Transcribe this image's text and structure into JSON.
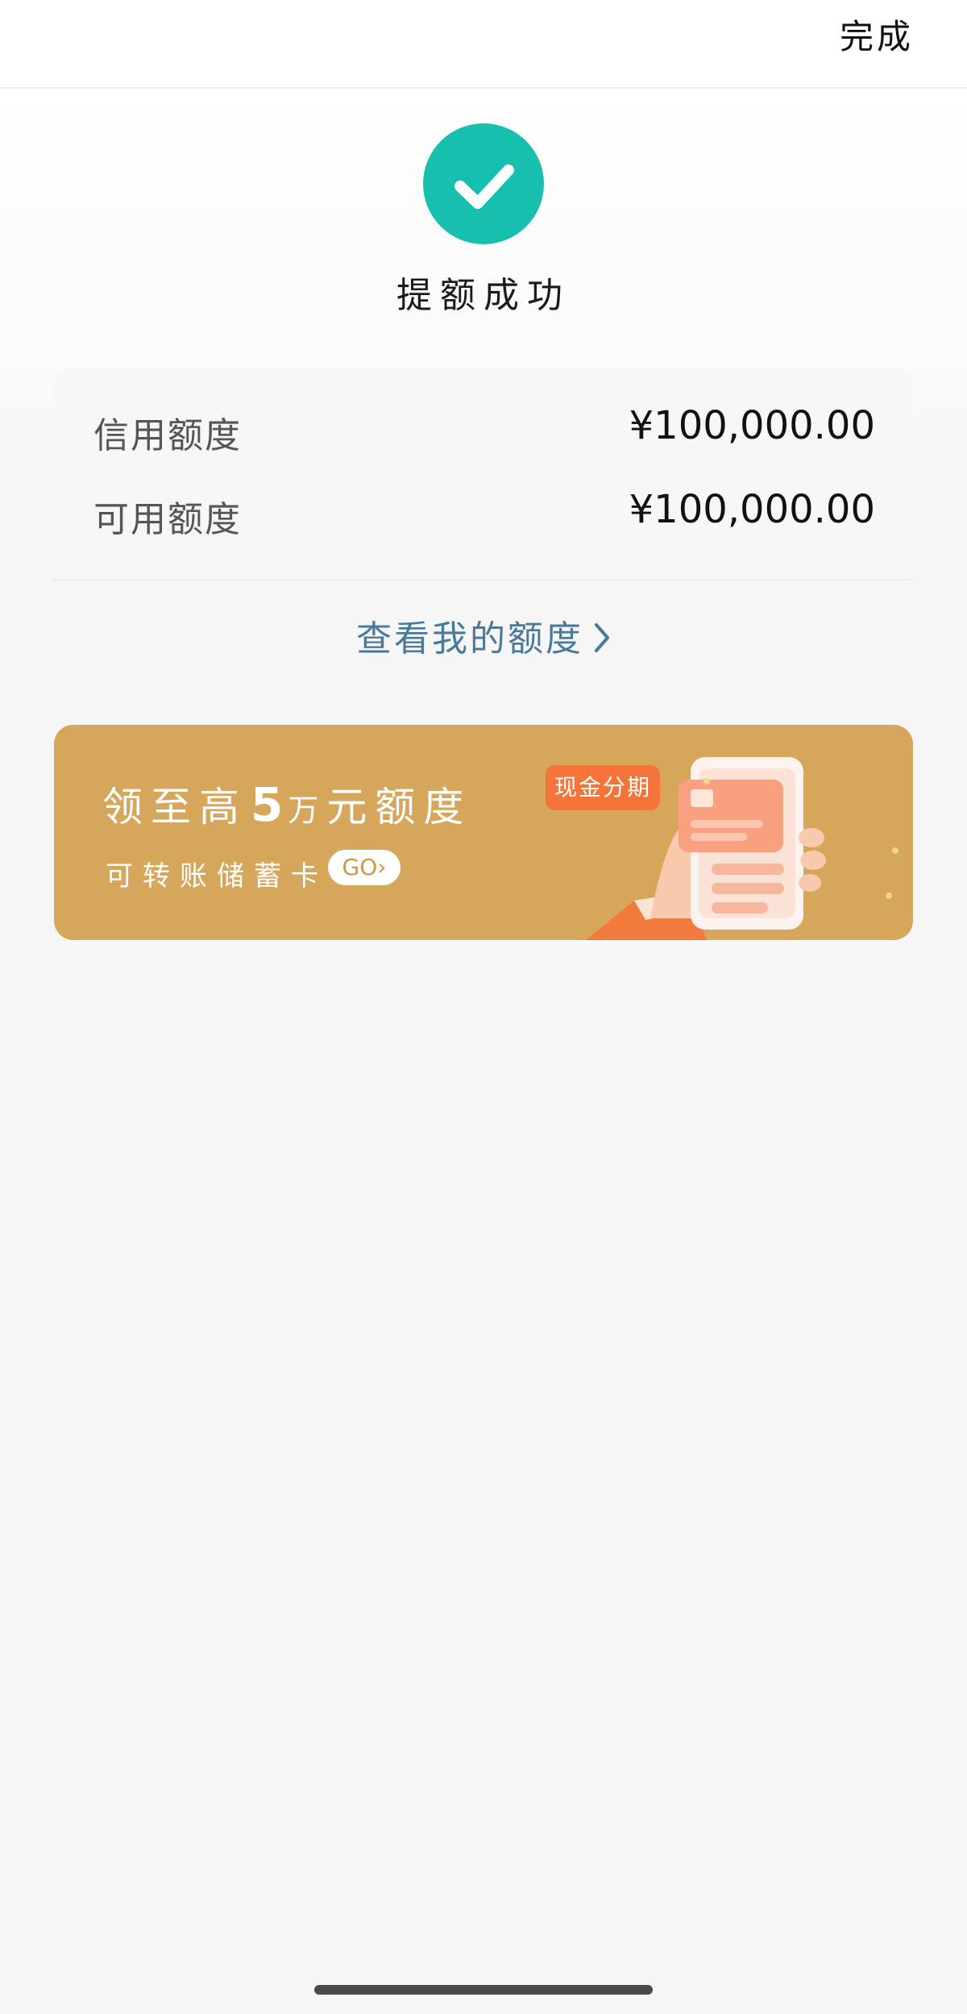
{
  "header": {
    "done_label": "完成"
  },
  "result": {
    "icon": "checkmark-icon",
    "title": "提额成功",
    "icon_color": "#17bfae"
  },
  "limits": {
    "rows": [
      {
        "label": "信用额度",
        "value": "¥100,000.00"
      },
      {
        "label": "可用额度",
        "value": "¥100,000.00"
      }
    ],
    "view_link_label": "查看我的额度",
    "link_color": "#4a7a99"
  },
  "promo": {
    "headline_prefix": "领至高",
    "headline_amount": "5",
    "headline_unit": "万",
    "headline_suffix": "元额度",
    "subtitle": "可转账储蓄卡",
    "go_label": "GO",
    "badge": "现金分期",
    "background_color": "#d6a65b"
  }
}
